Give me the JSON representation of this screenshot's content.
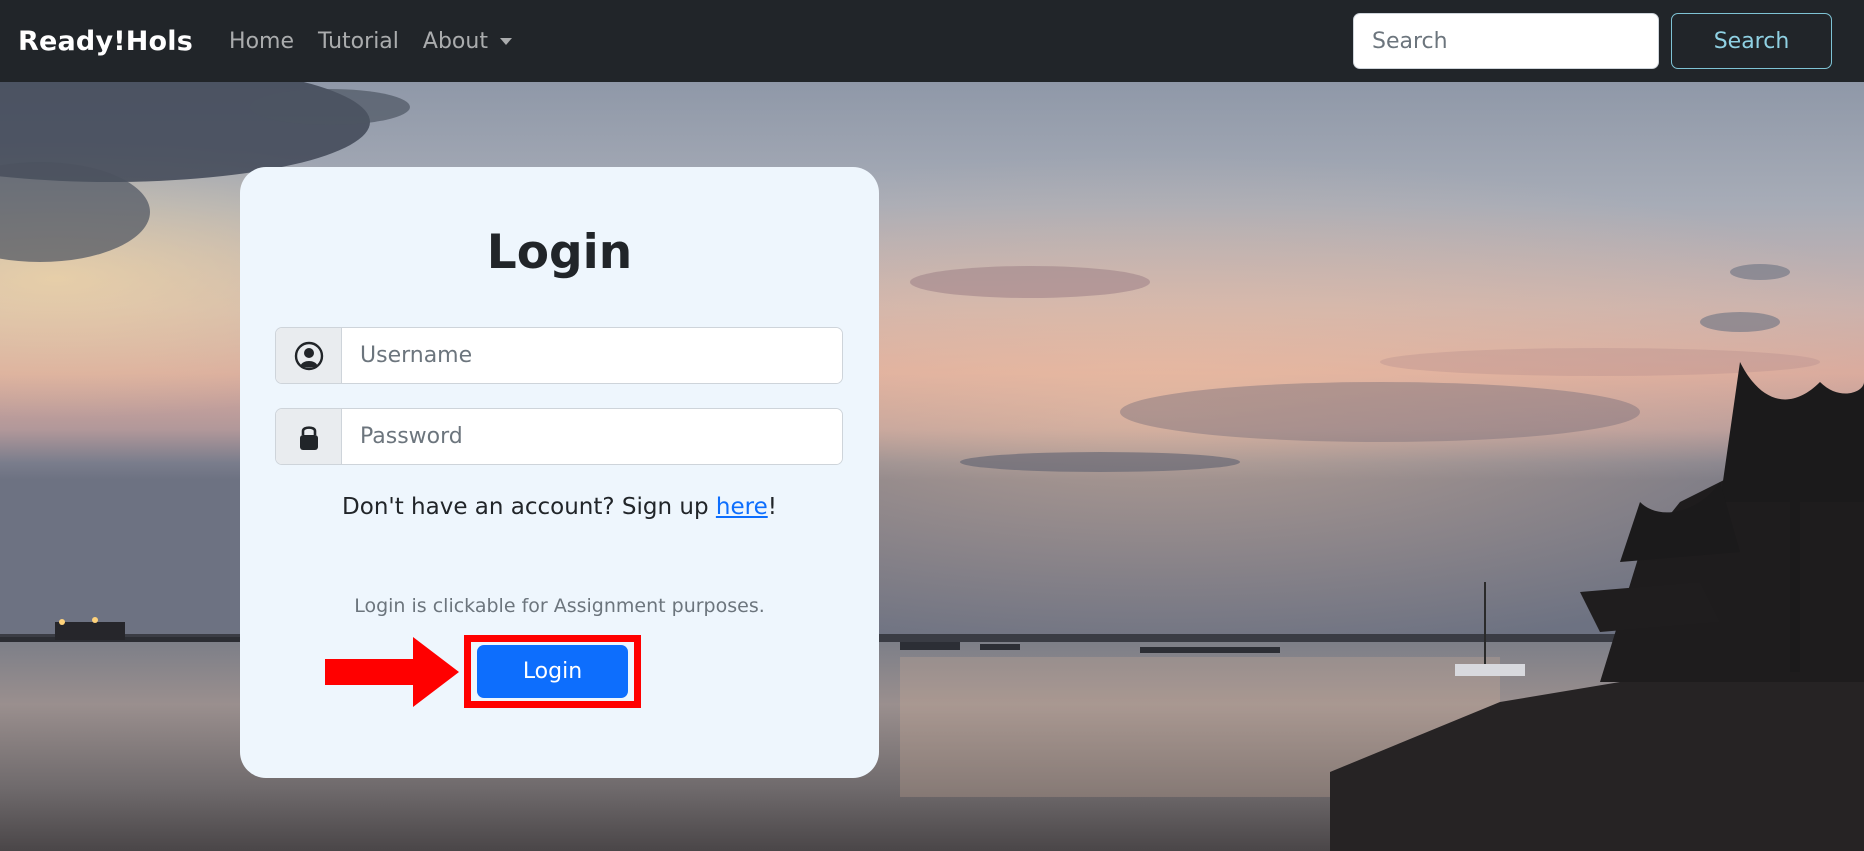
{
  "navbar": {
    "brand": "Ready!Hols",
    "links": [
      {
        "label": "Home"
      },
      {
        "label": "Tutorial"
      },
      {
        "label": "About",
        "dropdown": true
      }
    ],
    "search": {
      "placeholder": "Search",
      "button_label": "Search"
    }
  },
  "login": {
    "title": "Login",
    "username": {
      "placeholder": "Username",
      "icon": "user-circle-icon"
    },
    "password": {
      "placeholder": "Password",
      "icon": "lock-icon"
    },
    "signup_prefix": "Don't have an account? Sign up ",
    "signup_link": "here",
    "signup_suffix": "!",
    "note": "Login is clickable for Assignment purposes.",
    "button_label": "Login"
  },
  "colors": {
    "navbar_bg": "#212529",
    "primary": "#0d6efd",
    "annotation": "#ff0000",
    "card_bg": "#eef6fd"
  }
}
